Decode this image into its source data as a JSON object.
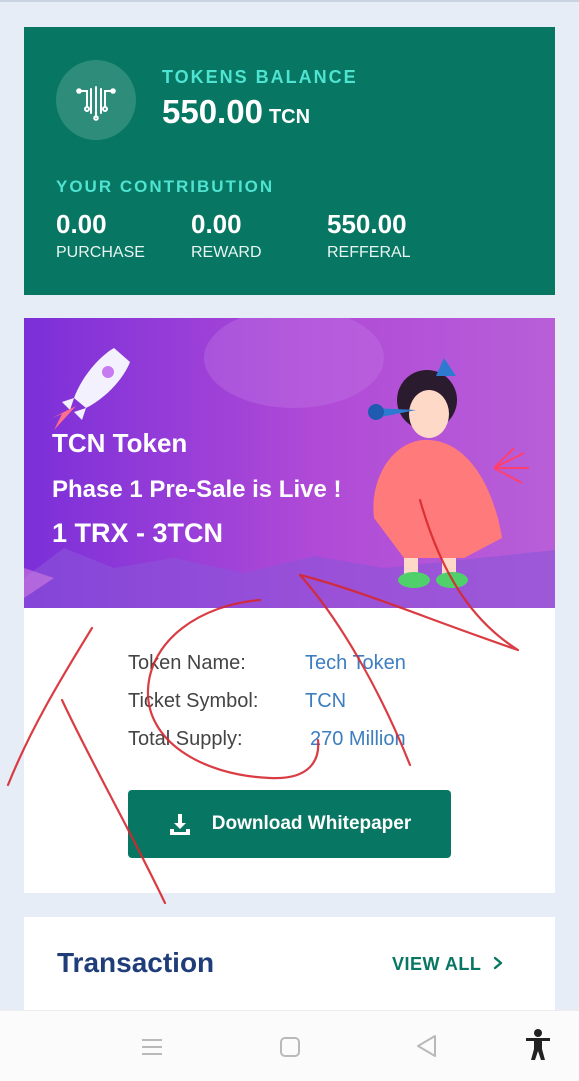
{
  "balance": {
    "label": "TOKENS BALANCE",
    "amount": "550.00",
    "unit": "TCN",
    "contribution_label": "YOUR CONTRIBUTION",
    "stats": [
      {
        "value": "0.00",
        "label": "PURCHASE"
      },
      {
        "value": "0.00",
        "label": "REWARD"
      },
      {
        "value": "550.00",
        "label": "REFFERAL"
      }
    ]
  },
  "banner": {
    "line1": "TCN Token",
    "line2": "Phase 1 Pre-Sale is Live !",
    "line3": "1 TRX - 3TCN"
  },
  "token_info": {
    "name_label": "Token Name:",
    "name_value": "Tech Token",
    "symbol_label": "Ticket Symbol:",
    "symbol_value": "TCN",
    "supply_label": "Total Supply:",
    "supply_value": "270 Million"
  },
  "download_button": "Download Whitepaper",
  "transaction": {
    "title": "Transaction",
    "view_all": "VIEW ALL"
  },
  "colors": {
    "brand_green": "#077662",
    "accent_teal": "#4fe3d1",
    "link_blue": "#3c7ec0",
    "title_navy": "#1f3d79",
    "annotation_red": "#d6282f"
  },
  "icons": {
    "logo": "circuit-logo-icon",
    "download": "download-icon",
    "chevron": "chevron-right-icon",
    "nav": [
      "menu-icon",
      "home-square-icon",
      "back-triangle-icon",
      "accessibility-icon"
    ]
  }
}
